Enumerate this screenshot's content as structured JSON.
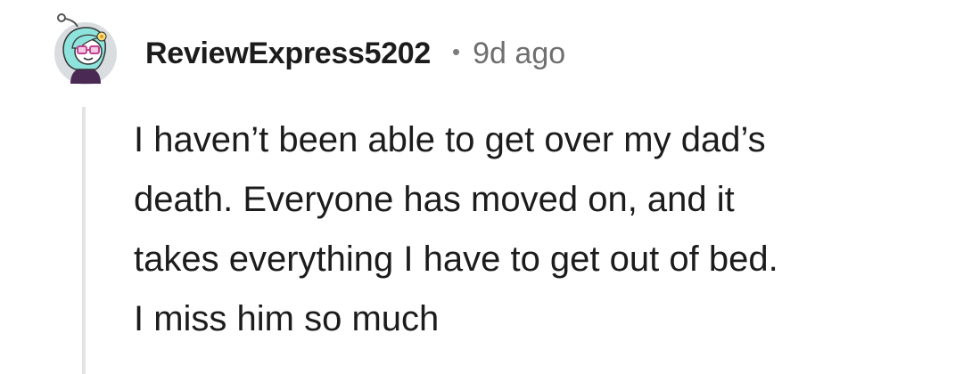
{
  "comment": {
    "author": "ReviewExpress5202",
    "separator": "•",
    "timestamp": "9d ago",
    "avatar_icon": "snoo-avatar-icon",
    "body_lines": [
      "I haven’t been able to get over my dad’s",
      "death. Everyone has moved on, and it",
      "takes everything I have to get out of bed.",
      "I miss him so much"
    ]
  },
  "colors": {
    "text": "#1c1c1c",
    "meta": "#6f6f6f",
    "thread_line": "#e3e3e3",
    "avatar_bg": "#d9dde0",
    "avatar_hair": "#8ee3dc",
    "avatar_glasses": "#c2448e"
  }
}
